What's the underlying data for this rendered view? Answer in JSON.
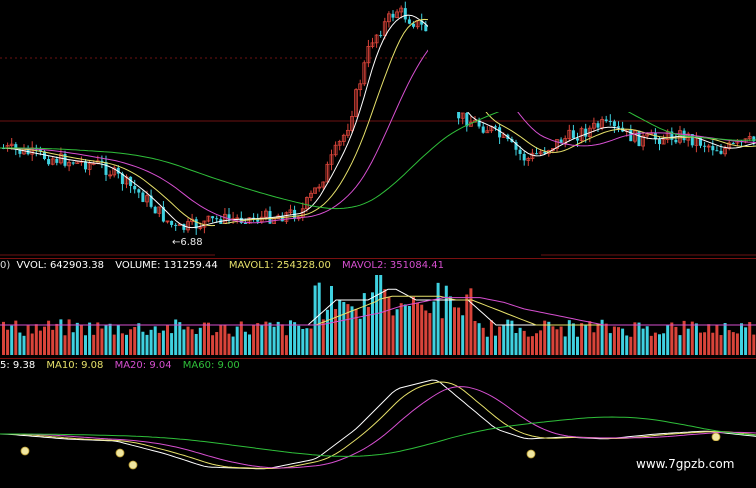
{
  "colors": {
    "up": "#d9443a",
    "down": "#3fd1e0",
    "ma5": "#ffffff",
    "ma10": "#e6e06a",
    "ma20": "#d64fd0",
    "ma60": "#2fbf3a",
    "grid": "#6b1212",
    "vol_line": "#ffffff",
    "mavol1": "#e6e06a",
    "mavol2": "#d64fd0"
  },
  "kline": {
    "low_marker": "←6.88"
  },
  "volume_legend": {
    "prefix": "0)",
    "vvol": "VVOL: 642903.38",
    "volume": "VOLUME: 131259.44",
    "mavol1": "MAVOL1: 254328.00",
    "mavol2": "MAVOL2: 351084.41"
  },
  "ma_legend": {
    "ma5": "5: 9.38",
    "ma10": "MA10: 9.08",
    "ma20": "MA20: 9.04",
    "ma60": "MA60: 9.00"
  },
  "signal_icon": "money-bag-icon",
  "watermark": "www.7gpzb.com"
}
